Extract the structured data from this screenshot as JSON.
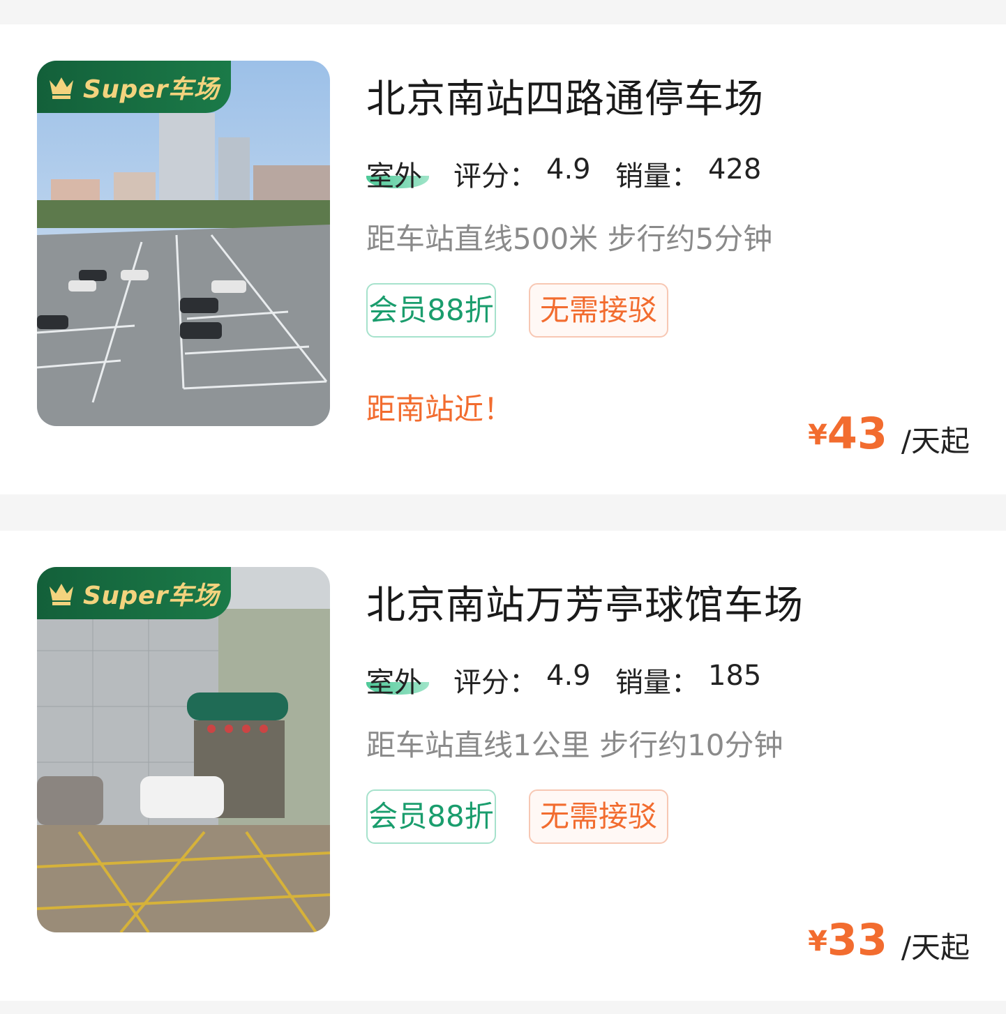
{
  "lots": [
    {
      "badge": "Super车场",
      "name": "北京南站四路通停车场",
      "type": "室外",
      "rating_label": "评分：",
      "rating": "4.9",
      "sales_label": "销量：",
      "sales": "428",
      "distance": "距车站直线500米 步行约5分钟",
      "tags": [
        "会员88折",
        "无需接驳"
      ],
      "slogan": "距南站近！",
      "price_currency": "¥",
      "price": "43",
      "price_unit": "/天起"
    },
    {
      "badge": "Super车场",
      "name": "北京南站万芳亭球馆车场",
      "type": "室外",
      "rating_label": "评分：",
      "rating": "4.9",
      "sales_label": "销量：",
      "sales": "185",
      "distance": "距车站直线1公里 步行约10分钟",
      "tags": [
        "会员88折",
        "无需接驳"
      ],
      "slogan": "",
      "price_currency": "¥",
      "price": "33",
      "price_unit": "/天起"
    }
  ],
  "colors": {
    "accent_orange": "#f26c2f",
    "accent_green": "#1a9d6d",
    "badge_green": "#13603a",
    "badge_gold": "#f3d37e"
  },
  "icons": [
    "crown-icon"
  ]
}
